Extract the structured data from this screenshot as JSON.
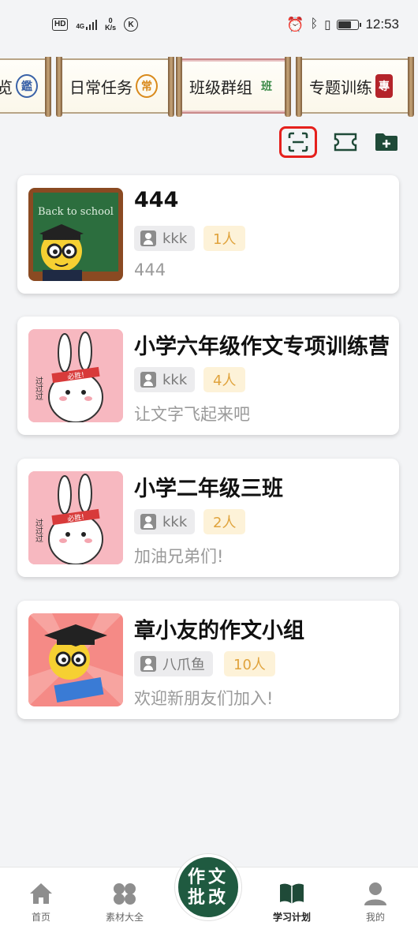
{
  "status_bar": {
    "hd": "HD",
    "signal": "4G",
    "net_speed": "0",
    "net_unit": "K/s",
    "k_icon": "K",
    "time": "12:53",
    "battery_level": 0.6
  },
  "tabs": [
    {
      "label": "览",
      "seal": "鑑",
      "seal_color": "#3a62a8"
    },
    {
      "label": "日常任务",
      "seal": "常",
      "seal_color": "#d98a1c"
    },
    {
      "label": "班级群组",
      "seal": "班",
      "seal_color": "#3c8a48"
    },
    {
      "label": "专题训练",
      "seal": "專",
      "seal_color": "#b4242a"
    }
  ],
  "toolbar": {
    "scan": "scan-icon",
    "ticket": "ticket-icon",
    "folder_add": "folder-add-icon"
  },
  "groups": [
    {
      "title": "444",
      "owner": "kkk",
      "count": "1人",
      "desc": "444",
      "avatar": "chalkboard-teacher"
    },
    {
      "title": "小学六年级作文专项训练营",
      "owner": "kkk",
      "count": "4人",
      "desc": "让文字飞起来吧",
      "avatar": "rabbit"
    },
    {
      "title": "小学二年级三班",
      "owner": "kkk",
      "count": "2人",
      "desc": "加油兄弟们!",
      "avatar": "rabbit"
    },
    {
      "title": "章小友的作文小组",
      "owner": "八爪鱼",
      "count": "10人",
      "desc": "欢迎新朋友们加入!",
      "avatar": "graduate"
    }
  ],
  "rabbit_text": {
    "headband": "必胜!",
    "side": "过过过"
  },
  "chalkboard_text": "Back to school",
  "nav": {
    "home": "首页",
    "materials": "素材大全",
    "center": "作文批改",
    "plan": "学习计划",
    "mine": "我的"
  },
  "colors": {
    "brand_green": "#1f5a40",
    "count_badge": "#e0a33c",
    "highlight": "#e5201c"
  }
}
